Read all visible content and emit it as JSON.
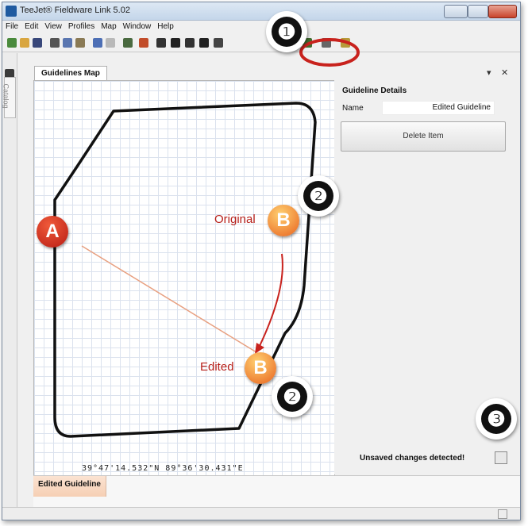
{
  "window": {
    "title": "TeeJet® Fieldware Link 5.02"
  },
  "menu": [
    "File",
    "Edit",
    "View",
    "Profiles",
    "Map",
    "Window",
    "Help"
  ],
  "sidebar": {
    "catalog_label": "Catalog"
  },
  "tabs": {
    "map_tab": "Guidelines Map",
    "pin_glyph": "▾",
    "close_glyph": "✕"
  },
  "map": {
    "coordinates": "39°47'14.532\"N 89°36'30.431\"E"
  },
  "details": {
    "title": "Guideline Details",
    "name_label": "Name",
    "name_value": "Edited Guideline",
    "delete_button": "Delete Item",
    "unsaved_text": "Unsaved changes detected!"
  },
  "bottom_panel": {
    "tab_label": "Edited Guideline"
  },
  "annotations": {
    "n1": "❶",
    "n2": "❷",
    "n3": "❸",
    "point_a": "A",
    "point_b": "B",
    "original_label": "Original",
    "edited_label": "Edited"
  },
  "colors": {
    "annotation_red": "#c8221d",
    "badge_orange": "#e8621e",
    "guideline": "#e8a080"
  }
}
